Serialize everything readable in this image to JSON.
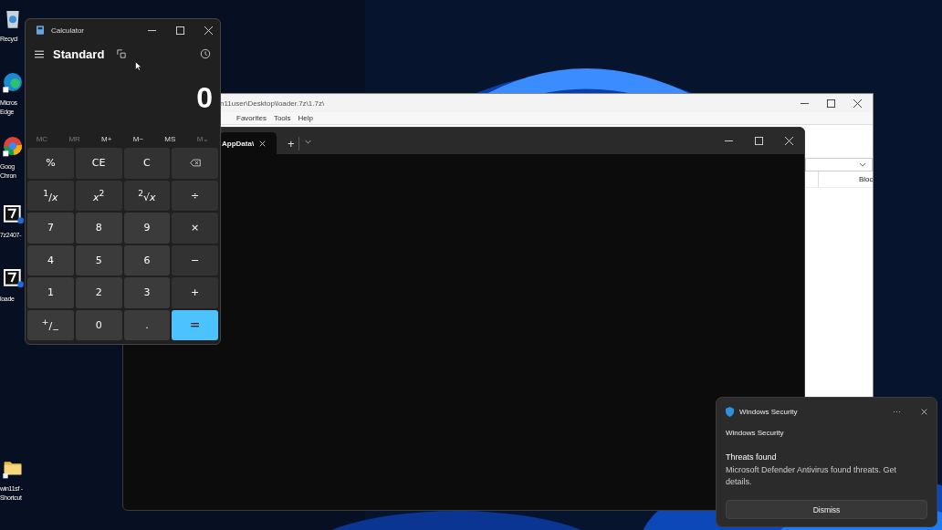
{
  "desktop_icons": [
    {
      "kind": "recycle",
      "label": [
        "Recycl"
      ]
    },
    {
      "kind": "edge",
      "label": [
        "Micros",
        "Edge"
      ]
    },
    {
      "kind": "chrome",
      "label": [
        "Goog",
        "Chron"
      ]
    },
    {
      "kind": "sevenzip",
      "label": [
        "7z2407-"
      ]
    },
    {
      "kind": "sevenzip",
      "label": [
        "loade"
      ]
    },
    {
      "kind": "folder",
      "label": [
        "win11sf -",
        "Shortcut"
      ]
    }
  ],
  "archive_window": {
    "title": "n11user\\Desktop\\loader.7z\\1.7z\\",
    "menu": [
      "Favorites",
      "Tools",
      "Help"
    ],
    "column_header": "Bloc"
  },
  "terminal": {
    "tab": "AppData\\",
    "new_tab": "+"
  },
  "calculator": {
    "title": "Calculator",
    "mode": "Standard",
    "display": "0",
    "memory": [
      {
        "label": "MC",
        "disabled": true
      },
      {
        "label": "MR",
        "disabled": true
      },
      {
        "label": "M+",
        "disabled": false
      },
      {
        "label": "M−",
        "disabled": false
      },
      {
        "label": "MS",
        "disabled": false
      },
      {
        "label": "M⌄",
        "disabled": true
      }
    ],
    "keys": [
      {
        "kind": "function",
        "label": "%"
      },
      {
        "kind": "function",
        "label": "CE"
      },
      {
        "kind": "function",
        "label": "C"
      },
      {
        "kind": "backspace"
      },
      {
        "kind": "function",
        "label": "$^{1}$/*x*"
      },
      {
        "kind": "function",
        "label": "*x*$^{2}$"
      },
      {
        "kind": "function",
        "label": "$^{2}$√*x*"
      },
      {
        "kind": "function",
        "label": "÷"
      },
      {
        "kind": "digit",
        "label": "7"
      },
      {
        "kind": "digit",
        "label": "8"
      },
      {
        "kind": "digit",
        "label": "9"
      },
      {
        "kind": "function",
        "label": "×"
      },
      {
        "kind": "digit",
        "label": "4"
      },
      {
        "kind": "digit",
        "label": "5"
      },
      {
        "kind": "digit",
        "label": "6"
      },
      {
        "kind": "function",
        "label": "−"
      },
      {
        "kind": "digit",
        "label": "1"
      },
      {
        "kind": "digit",
        "label": "2"
      },
      {
        "kind": "digit",
        "label": "3"
      },
      {
        "kind": "function",
        "label": "+"
      },
      {
        "kind": "digit",
        "label": "$^{+}$/$_{−}$"
      },
      {
        "kind": "digit",
        "label": "0"
      },
      {
        "kind": "digit",
        "label": "."
      },
      {
        "kind": "equals",
        "label": "="
      }
    ]
  },
  "notification": {
    "app": "Windows Security",
    "more": "···",
    "header": "Windows Security",
    "title": "Threats found",
    "body": "Microsoft Defender Antivirus found threats. Get details.",
    "button": "Dismiss"
  }
}
